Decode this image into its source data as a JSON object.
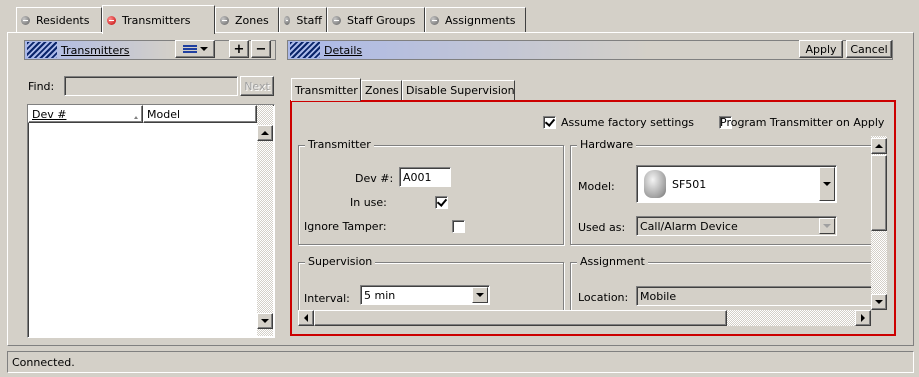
{
  "top_tabs": [
    {
      "label": "Residents",
      "active": false
    },
    {
      "label": "Transmitters",
      "active": true
    },
    {
      "label": "Zones",
      "active": false
    },
    {
      "label": "Staff",
      "active": false
    },
    {
      "label": "Staff Groups",
      "active": false
    },
    {
      "label": "Assignments",
      "active": false
    }
  ],
  "left_panel": {
    "title": "Transmitters",
    "view_menu_icon": "list-view-icon",
    "add_label": "+",
    "remove_label": "−",
    "find_label": "Find:",
    "find_value": "",
    "next_label": "Next",
    "columns": [
      "Dev #",
      "Model"
    ]
  },
  "right_panel": {
    "title": "Details",
    "apply_label": "Apply",
    "cancel_label": "Cancel",
    "tabs": [
      "Transmitter",
      "Zones",
      "Disable Supervision"
    ],
    "assume_factory": {
      "label": "Assume factory settings",
      "checked": true
    },
    "program_transmitter": {
      "label": "Program Transmitter on Apply",
      "checked": false
    },
    "transmitter_group": {
      "legend": "Transmitter",
      "dev_label": "Dev #:",
      "dev_value": "A001",
      "in_use_label": "In use:",
      "in_use_checked": true,
      "ignore_tamper_label": "Ignore Tamper:",
      "ignore_tamper_checked": false
    },
    "hardware_group": {
      "legend": "Hardware",
      "model_label": "Model:",
      "model_value": "SF501",
      "used_as_label": "Used as:",
      "used_as_value": "Call/Alarm Device"
    },
    "supervision_group": {
      "legend": "Supervision",
      "interval_label": "Interval:",
      "interval_value": "5 min"
    },
    "assignment_group": {
      "legend": "Assignment",
      "location_label": "Location:",
      "location_value": "Mobile"
    },
    "accent_border_color": "#cc0000"
  },
  "status": {
    "text": "Connected."
  }
}
